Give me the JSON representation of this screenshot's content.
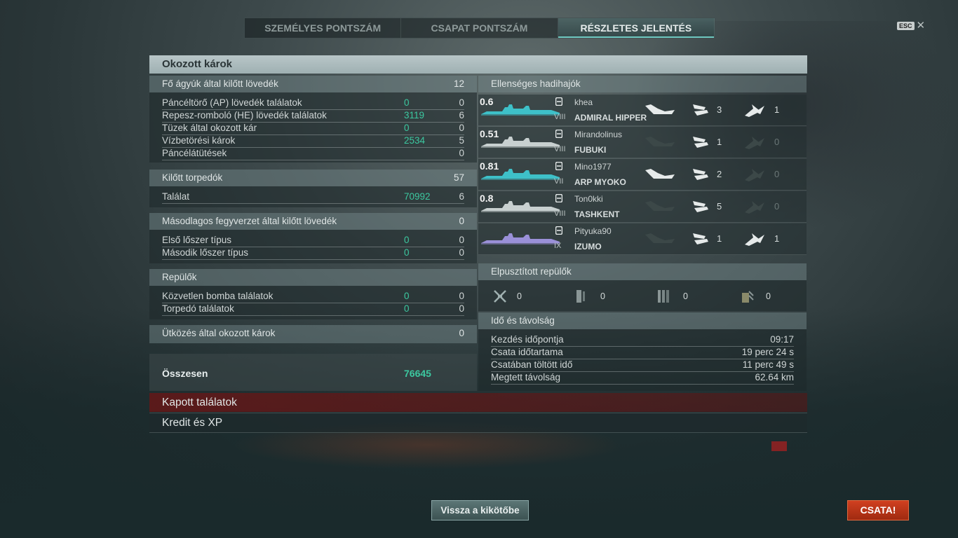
{
  "tabs": [
    "SZEMÉLYES PONTSZÁM",
    "CSAPAT PONTSZÁM",
    "RÉSZLETES JELENTÉS"
  ],
  "esc_label": "ESC",
  "header_title": "Okozott károk",
  "main_guns": {
    "title": "Fő ágyúk által kilőtt lövedék",
    "total": "12",
    "rows": [
      {
        "label": "Páncéltörő (AP) lövedék találatok",
        "dmg": "0",
        "count": "0"
      },
      {
        "label": "Repesz-romboló (HE) lövedék találatok",
        "dmg": "3119",
        "count": "6"
      },
      {
        "label": "Tüzek által okozott kár",
        "dmg": "0",
        "count": "0"
      },
      {
        "label": "Vízbetörési károk",
        "dmg": "2534",
        "count": "5"
      },
      {
        "label": "Páncélátütések",
        "dmg": "",
        "count": "0"
      }
    ]
  },
  "torpedoes": {
    "title": "Kilőtt torpedók",
    "total": "57",
    "rows": [
      {
        "label": "Találat",
        "dmg": "70992",
        "count": "6"
      }
    ]
  },
  "secondary": {
    "title": "Másodlagos fegyverzet által kilőtt lövedék",
    "total": "0",
    "rows": [
      {
        "label": "Első lőszer típus",
        "dmg": "0",
        "count": "0"
      },
      {
        "label": "Második lőszer típus",
        "dmg": "0",
        "count": "0"
      }
    ]
  },
  "planes": {
    "title": "Repülők",
    "rows": [
      {
        "label": "Közvetlen bomba találatok",
        "dmg": "0",
        "count": "0"
      },
      {
        "label": "Torpedó találatok",
        "dmg": "0",
        "count": "0"
      }
    ]
  },
  "ramming": {
    "label": "Ütközés által okozott károk",
    "value": "0"
  },
  "total": {
    "label": "Összesen",
    "value": "76645"
  },
  "enemy_ships": {
    "title": "Ellenséges hadihajók",
    "ships": [
      {
        "hp": "0.6",
        "player": "khea",
        "name": "ADMIRAL HIPPER",
        "tier": "VIII",
        "hits": "3",
        "torps": "1",
        "sunk": true,
        "color": "#3ec0c8"
      },
      {
        "hp": "0.51",
        "player": "Mirandolinus",
        "name": "FUBUKI",
        "tier": "VIII",
        "hits": "1",
        "torps": "0",
        "sunk": false,
        "color": "#c8d0d0"
      },
      {
        "hp": "0.81",
        "player": "Mino1977",
        "name": "ARP MYOKO",
        "tier": "VII",
        "hits": "2",
        "torps": "0",
        "sunk": true,
        "color": "#3ec0c8"
      },
      {
        "hp": "0.8",
        "player": "Ton0kki",
        "name": "TASHKENT",
        "tier": "VIII",
        "hits": "5",
        "torps": "0",
        "sunk": false,
        "color": "#c8d0d0"
      },
      {
        "hp": "",
        "player": "Pityuka90",
        "name": "IZUMO",
        "tier": "IX",
        "hits": "1",
        "torps": "1",
        "sunk": false,
        "color": "#9a90d8"
      }
    ]
  },
  "destroyed_planes": {
    "title": "Elpusztított repülők",
    "counts": [
      "0",
      "0",
      "0",
      "0"
    ]
  },
  "time": {
    "title": "Idő és távolság",
    "rows": [
      {
        "label": "Kezdés időpontja",
        "value": "09:17"
      },
      {
        "label": "Csata időtartama",
        "value": "19 perc 24 s"
      },
      {
        "label": "Csatában töltött idő",
        "value": "11 perc 49 s"
      },
      {
        "label": "Megtett távolság",
        "value": "62.64 km"
      }
    ]
  },
  "received_hits": "Kapott találatok",
  "credits_xp": "Kredit és XP",
  "back_to_port": "Vissza a kikötőbe",
  "battle_button": "CSATA!"
}
